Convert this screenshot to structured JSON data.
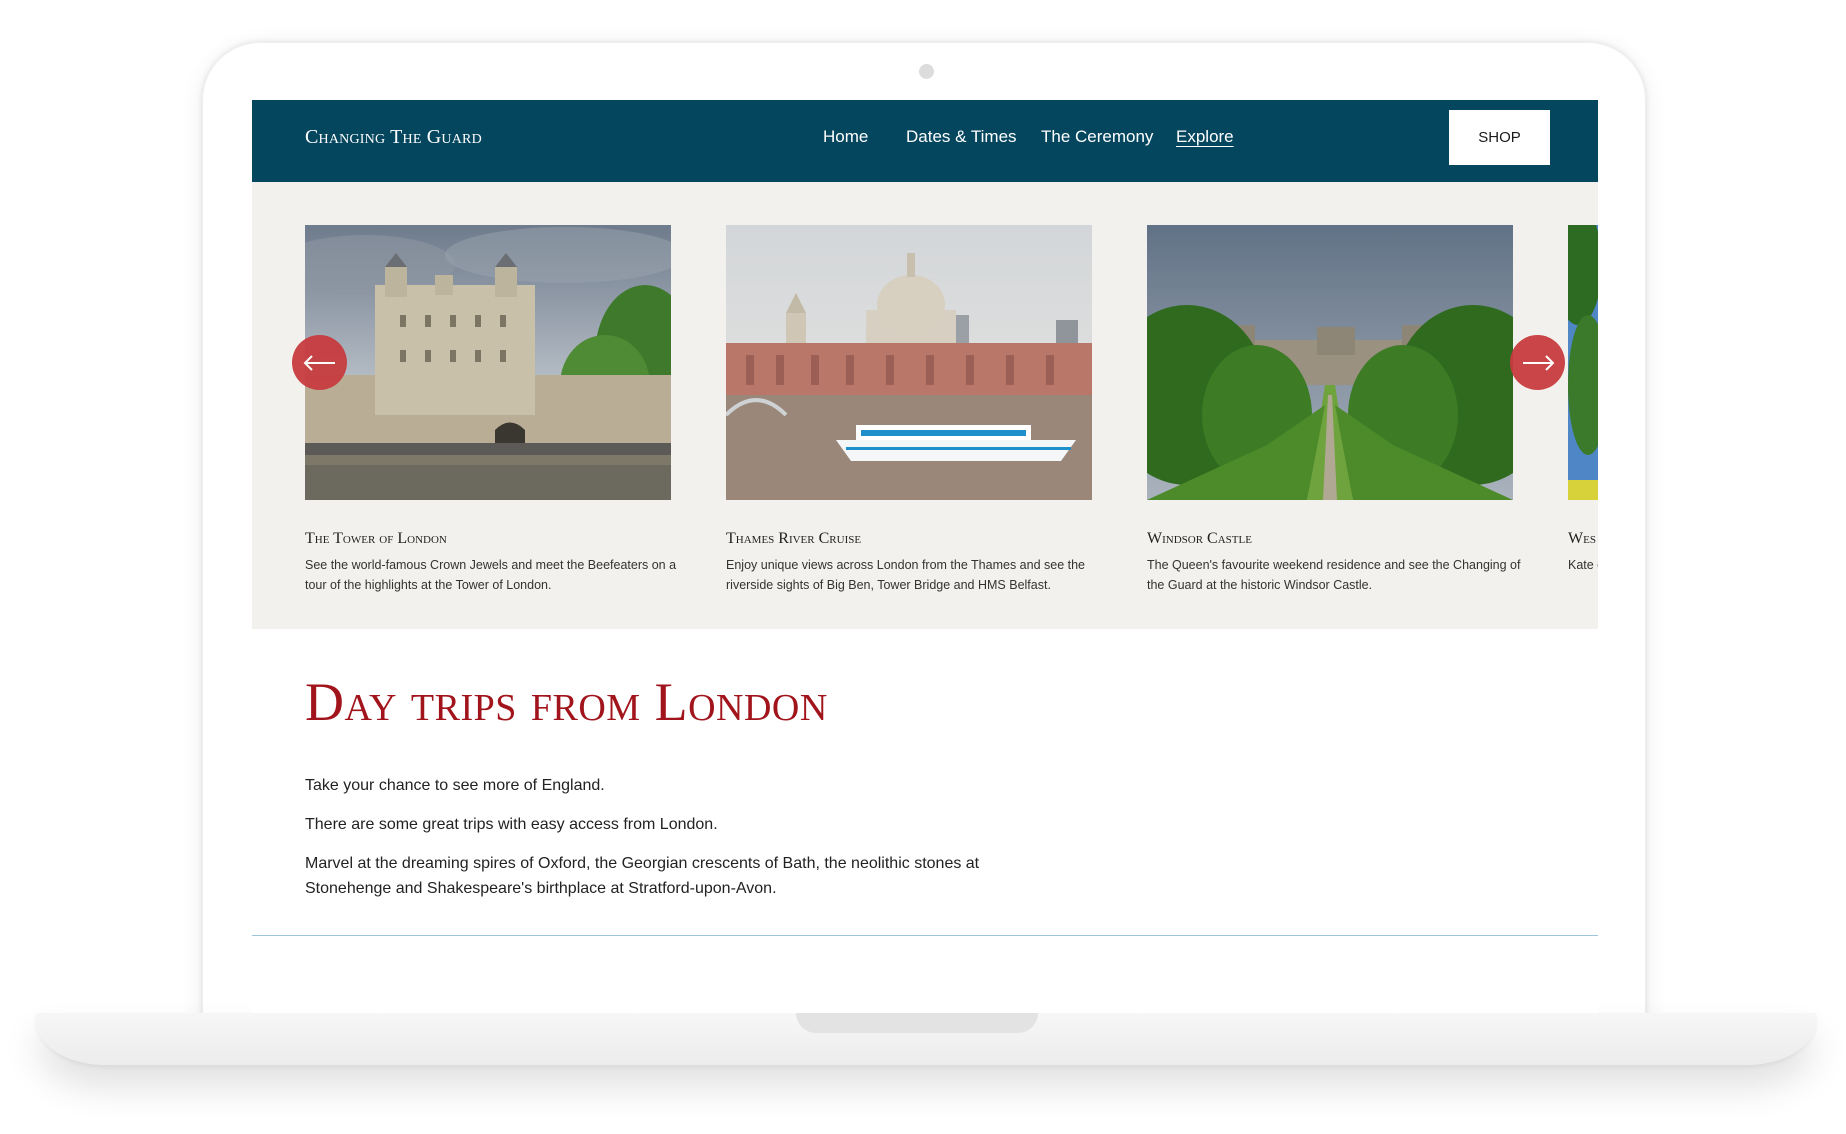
{
  "nav": {
    "brand": "Changing The Guard",
    "links": [
      {
        "label": "Home"
      },
      {
        "label": "Dates & Times"
      },
      {
        "label": "The Ceremony"
      },
      {
        "label": "Explore",
        "active": true
      }
    ],
    "shop_label": "SHOP"
  },
  "carousel": {
    "cards": [
      {
        "title": "The Tower of London",
        "description": "See the world-famous Crown Jewels and meet the Beefeaters on a tour of the highlights at the Tower of London."
      },
      {
        "title": "Thames River Cruise",
        "description": "Enjoy unique views across London from the Thames and see the riverside sights of Big Ben, Tower Bridge and HMS Belfast."
      },
      {
        "title": "Windsor Castle",
        "description": "The Queen's favourite weekend residence and see the Changing of the Guard at the historic Windsor Castle."
      },
      {
        "title": "Wes",
        "description": "Kate churc"
      }
    ],
    "prev_icon": "arrow-left-icon",
    "next_icon": "arrow-right-icon"
  },
  "content": {
    "title": "Day trips from London",
    "paragraphs": [
      "Take your chance to see more of England.",
      "There are some great trips with easy access from London.",
      "Marvel at the dreaming spires of Oxford, the Georgian crescents of Bath, the neolithic stones at Stonehenge and Shakespeare's birthplace at Stratford-upon-Avon."
    ]
  },
  "colors": {
    "nav_background": "#05465f",
    "carousel_background": "#f2f1ed",
    "title_red": "#a1141b",
    "arrow_red": "#c73c3f",
    "divider_blue": "#9cc4dd"
  }
}
